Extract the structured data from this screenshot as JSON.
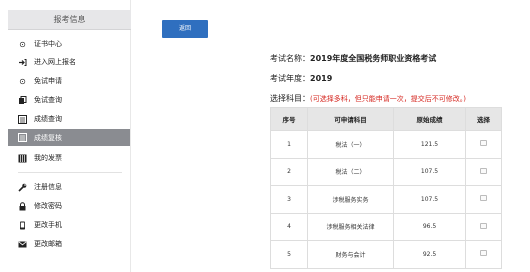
{
  "sidebar": {
    "header": "报考信息",
    "items": [
      {
        "label": "证书中心",
        "icon": "ring"
      },
      {
        "label": "进入网上报名",
        "icon": "login"
      },
      {
        "label": "免试申请",
        "icon": "ring"
      },
      {
        "label": "免试查询",
        "icon": "docs"
      },
      {
        "label": "成绩查询",
        "icon": "list"
      },
      {
        "label": "成绩复核",
        "icon": "list"
      },
      {
        "label": "我的发票",
        "icon": "receipt"
      },
      {
        "label": "注册信息",
        "icon": "wrench"
      },
      {
        "label": "修改密码",
        "icon": "lock"
      },
      {
        "label": "更改手机",
        "icon": "phone"
      },
      {
        "label": "更改邮箱",
        "icon": "mail"
      }
    ],
    "active_index": 5
  },
  "main": {
    "back_label": "返回",
    "exam_name_label": "考试名称：",
    "exam_name": "2019年度全国税务师职业资格考试",
    "exam_year_label": "考试年度：",
    "exam_year": "2019",
    "subject_label": "选择科目：",
    "subject_note": "(可选择多科，但只能申请一次，提交后不可修改。)",
    "table": {
      "headers": [
        "序号",
        "可申请科目",
        "原始成绩",
        "选择"
      ],
      "rows": [
        {
          "no": "1",
          "subject": "税法（一）",
          "score": "121.5",
          "checked": false
        },
        {
          "no": "2",
          "subject": "税法（二）",
          "score": "107.5",
          "checked": false
        },
        {
          "no": "3",
          "subject": "涉税服务实务",
          "score": "107.5",
          "checked": false
        },
        {
          "no": "4",
          "subject": "涉税服务相关法律",
          "score": "96.5",
          "checked": false
        },
        {
          "no": "5",
          "subject": "财务与会计",
          "score": "92.5",
          "checked": false
        }
      ]
    }
  }
}
